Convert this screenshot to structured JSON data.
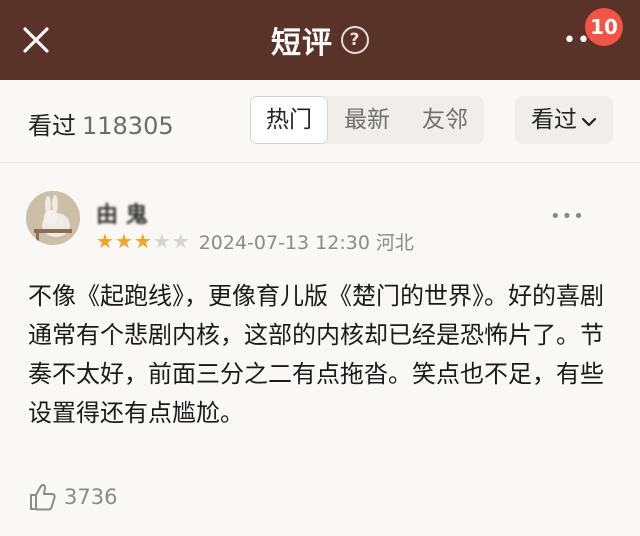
{
  "header": {
    "title": "短评",
    "help_icon_glyph": "?",
    "more_glyph": "•••",
    "badge_count": "10",
    "bg_color": "#5a3328"
  },
  "subbar": {
    "seen_label": "看过",
    "seen_count": "118305",
    "tabs": [
      {
        "label": "热门",
        "active": true
      },
      {
        "label": "最新",
        "active": false
      },
      {
        "label": "友邻",
        "active": false
      }
    ],
    "filter_label": "看过"
  },
  "review": {
    "username": "由 鬼",
    "rating": 3,
    "rating_max": 5,
    "date": "2024-07-13 12:30",
    "location": "河北",
    "content": "不像《起跑线》，更像育儿版《楚门的世界》。好的喜剧通常有个悲剧内核，这部的内核却已经是恐怖片了。节奏不太好，前面三分之二有点拖沓。笑点也不足，有些设置得还有点尴尬。",
    "likes": "3736",
    "more_glyph": "•••",
    "star_color": "#f0a524"
  }
}
